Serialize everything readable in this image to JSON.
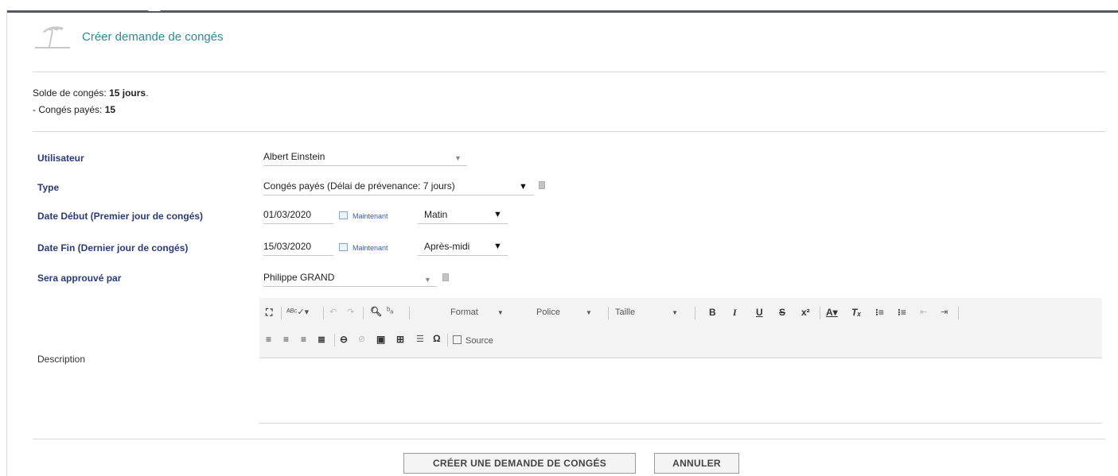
{
  "header": {
    "title": "Créer demande de congés",
    "icon": "umbrella-icon"
  },
  "balance": {
    "total_prefix": "Solde de congés: ",
    "total_value": "15 jours",
    "total_suffix": ".",
    "paid_prefix": "- Congés payés: ",
    "paid_value": "15"
  },
  "form": {
    "user": {
      "label": "Utilisateur",
      "value": "Albert Einstein"
    },
    "type": {
      "label": "Type",
      "value": "Congés payés (Délai de prévenance: 7 jours)"
    },
    "start": {
      "label": "Date Début (Premier jour de congés)",
      "date": "01/03/2020",
      "now": "Maintenant",
      "period": "Matin"
    },
    "end": {
      "label": "Date Fin (Dernier jour de congés)",
      "date": "15/03/2020",
      "now": "Maintenant",
      "period": "Après-midi"
    },
    "approver": {
      "label": "Sera approuvé par",
      "value": "Philippe GRAND"
    },
    "description": {
      "label": "Description"
    }
  },
  "editor": {
    "format": "Format",
    "font": "Police",
    "size": "Taille",
    "source": "Source"
  },
  "buttons": {
    "create": "CRÉER UNE DEMANDE DE CONGÉS",
    "cancel": "ANNULER"
  }
}
